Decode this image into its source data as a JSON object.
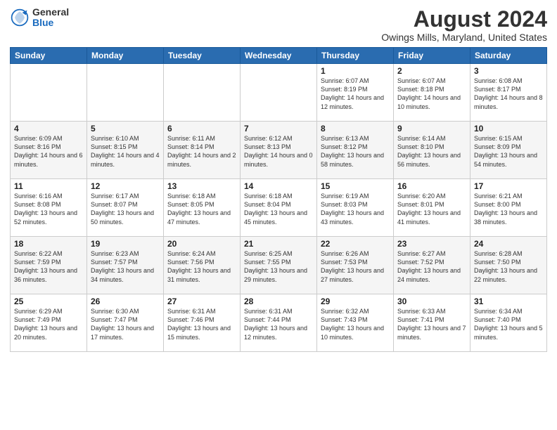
{
  "logo": {
    "general": "General",
    "blue": "Blue"
  },
  "title": "August 2024",
  "location": "Owings Mills, Maryland, United States",
  "days_of_week": [
    "Sunday",
    "Monday",
    "Tuesday",
    "Wednesday",
    "Thursday",
    "Friday",
    "Saturday"
  ],
  "weeks": [
    [
      {
        "day": "",
        "info": ""
      },
      {
        "day": "",
        "info": ""
      },
      {
        "day": "",
        "info": ""
      },
      {
        "day": "",
        "info": ""
      },
      {
        "day": "1",
        "info": "Sunrise: 6:07 AM\nSunset: 8:19 PM\nDaylight: 14 hours\nand 12 minutes."
      },
      {
        "day": "2",
        "info": "Sunrise: 6:07 AM\nSunset: 8:18 PM\nDaylight: 14 hours\nand 10 minutes."
      },
      {
        "day": "3",
        "info": "Sunrise: 6:08 AM\nSunset: 8:17 PM\nDaylight: 14 hours\nand 8 minutes."
      }
    ],
    [
      {
        "day": "4",
        "info": "Sunrise: 6:09 AM\nSunset: 8:16 PM\nDaylight: 14 hours\nand 6 minutes."
      },
      {
        "day": "5",
        "info": "Sunrise: 6:10 AM\nSunset: 8:15 PM\nDaylight: 14 hours\nand 4 minutes."
      },
      {
        "day": "6",
        "info": "Sunrise: 6:11 AM\nSunset: 8:14 PM\nDaylight: 14 hours\nand 2 minutes."
      },
      {
        "day": "7",
        "info": "Sunrise: 6:12 AM\nSunset: 8:13 PM\nDaylight: 14 hours\nand 0 minutes."
      },
      {
        "day": "8",
        "info": "Sunrise: 6:13 AM\nSunset: 8:12 PM\nDaylight: 13 hours\nand 58 minutes."
      },
      {
        "day": "9",
        "info": "Sunrise: 6:14 AM\nSunset: 8:10 PM\nDaylight: 13 hours\nand 56 minutes."
      },
      {
        "day": "10",
        "info": "Sunrise: 6:15 AM\nSunset: 8:09 PM\nDaylight: 13 hours\nand 54 minutes."
      }
    ],
    [
      {
        "day": "11",
        "info": "Sunrise: 6:16 AM\nSunset: 8:08 PM\nDaylight: 13 hours\nand 52 minutes."
      },
      {
        "day": "12",
        "info": "Sunrise: 6:17 AM\nSunset: 8:07 PM\nDaylight: 13 hours\nand 50 minutes."
      },
      {
        "day": "13",
        "info": "Sunrise: 6:18 AM\nSunset: 8:05 PM\nDaylight: 13 hours\nand 47 minutes."
      },
      {
        "day": "14",
        "info": "Sunrise: 6:18 AM\nSunset: 8:04 PM\nDaylight: 13 hours\nand 45 minutes."
      },
      {
        "day": "15",
        "info": "Sunrise: 6:19 AM\nSunset: 8:03 PM\nDaylight: 13 hours\nand 43 minutes."
      },
      {
        "day": "16",
        "info": "Sunrise: 6:20 AM\nSunset: 8:01 PM\nDaylight: 13 hours\nand 41 minutes."
      },
      {
        "day": "17",
        "info": "Sunrise: 6:21 AM\nSunset: 8:00 PM\nDaylight: 13 hours\nand 38 minutes."
      }
    ],
    [
      {
        "day": "18",
        "info": "Sunrise: 6:22 AM\nSunset: 7:59 PM\nDaylight: 13 hours\nand 36 minutes."
      },
      {
        "day": "19",
        "info": "Sunrise: 6:23 AM\nSunset: 7:57 PM\nDaylight: 13 hours\nand 34 minutes."
      },
      {
        "day": "20",
        "info": "Sunrise: 6:24 AM\nSunset: 7:56 PM\nDaylight: 13 hours\nand 31 minutes."
      },
      {
        "day": "21",
        "info": "Sunrise: 6:25 AM\nSunset: 7:55 PM\nDaylight: 13 hours\nand 29 minutes."
      },
      {
        "day": "22",
        "info": "Sunrise: 6:26 AM\nSunset: 7:53 PM\nDaylight: 13 hours\nand 27 minutes."
      },
      {
        "day": "23",
        "info": "Sunrise: 6:27 AM\nSunset: 7:52 PM\nDaylight: 13 hours\nand 24 minutes."
      },
      {
        "day": "24",
        "info": "Sunrise: 6:28 AM\nSunset: 7:50 PM\nDaylight: 13 hours\nand 22 minutes."
      }
    ],
    [
      {
        "day": "25",
        "info": "Sunrise: 6:29 AM\nSunset: 7:49 PM\nDaylight: 13 hours\nand 20 minutes."
      },
      {
        "day": "26",
        "info": "Sunrise: 6:30 AM\nSunset: 7:47 PM\nDaylight: 13 hours\nand 17 minutes."
      },
      {
        "day": "27",
        "info": "Sunrise: 6:31 AM\nSunset: 7:46 PM\nDaylight: 13 hours\nand 15 minutes."
      },
      {
        "day": "28",
        "info": "Sunrise: 6:31 AM\nSunset: 7:44 PM\nDaylight: 13 hours\nand 12 minutes."
      },
      {
        "day": "29",
        "info": "Sunrise: 6:32 AM\nSunset: 7:43 PM\nDaylight: 13 hours\nand 10 minutes."
      },
      {
        "day": "30",
        "info": "Sunrise: 6:33 AM\nSunset: 7:41 PM\nDaylight: 13 hours\nand 7 minutes."
      },
      {
        "day": "31",
        "info": "Sunrise: 6:34 AM\nSunset: 7:40 PM\nDaylight: 13 hours\nand 5 minutes."
      }
    ]
  ]
}
